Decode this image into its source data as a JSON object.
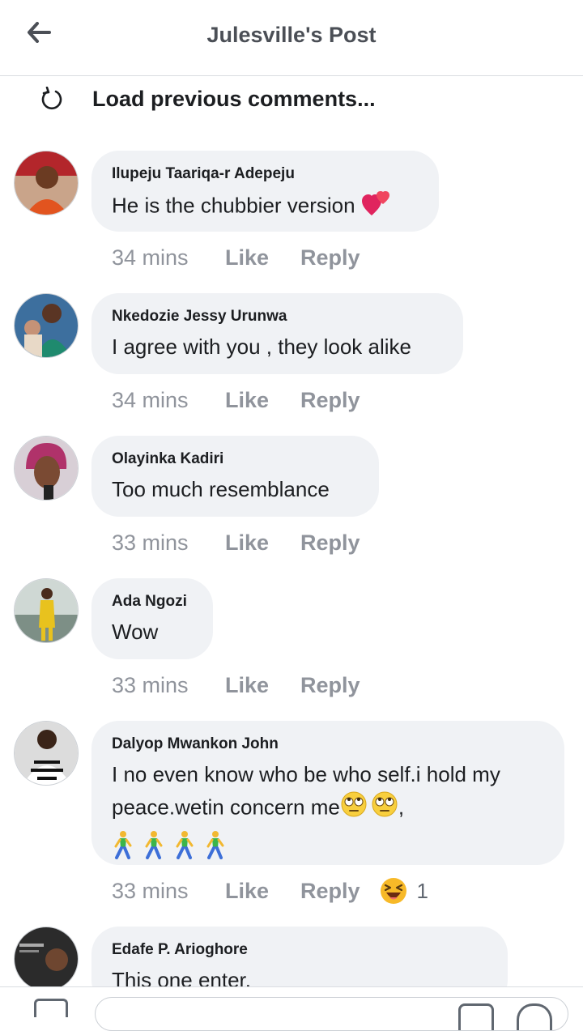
{
  "header": {
    "title": "Julesville's Post"
  },
  "load_previous": {
    "label": "Load previous comments..."
  },
  "comments": [
    {
      "author": "Ilupeju Taariqa-r Adepeju",
      "text": "He is the chubbier version",
      "time": "34 mins",
      "like": "Like",
      "reply": "Reply"
    },
    {
      "author": "Nkedozie Jessy Urunwa",
      "text": "I agree with you , they look alike",
      "time": "34 mins",
      "like": "Like",
      "reply": "Reply"
    },
    {
      "author": "Olayinka Kadiri",
      "text": "Too much resemblance",
      "time": "33 mins",
      "like": "Like",
      "reply": "Reply"
    },
    {
      "author": "Ada Ngozi",
      "text": "Wow",
      "time": "33 mins",
      "like": "Like",
      "reply": "Reply"
    },
    {
      "author": "Dalyop Mwankon John",
      "text_line1": "I no even know who be who self.i hold my",
      "text_line2": "peace.wetin concern me",
      "text_line2_suffix": ",",
      "time": "33 mins",
      "like": "Like",
      "reply": "Reply",
      "reaction_count": "1"
    },
    {
      "author": "Edafe P. Arioghore",
      "text": "This one enter."
    }
  ],
  "colors": {
    "bubble": "#f0f2f5",
    "meta_text": "#90949c",
    "header_text": "#4b4f56",
    "heart": "#e0245e"
  },
  "icons": [
    "back-arrow-icon",
    "reload-icon",
    "heart-emoji-icon",
    "eye-roll-emoji-icon",
    "walking-person-emoji-icon",
    "laughing-emoji-icon",
    "camera-icon",
    "sticker-icon",
    "emoji-icon"
  ]
}
